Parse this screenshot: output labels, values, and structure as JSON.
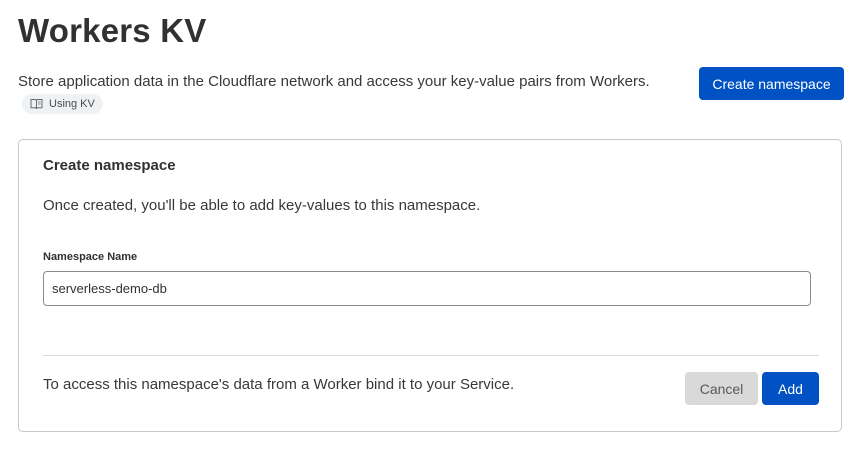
{
  "header": {
    "title": "Workers KV",
    "description": "Store application data in the Cloudflare network and access your key-value pairs from Workers.",
    "doc_link": {
      "icon": "book-icon",
      "label": "Using KV"
    },
    "create_button_label": "Create namespace"
  },
  "create_panel": {
    "title": "Create namespace",
    "description": "Once created, you'll be able to add key-values to this namespace.",
    "field_label": "Namespace Name",
    "field_value": "serverless-demo-db",
    "footer_text": "To access this namespace's data from a Worker bind it to your Service.",
    "cancel_label": "Cancel",
    "add_label": "Add"
  },
  "colors": {
    "primary": "#0051c3",
    "cancel_bg": "#d9d9d9",
    "pill_bg": "#eef2f5"
  }
}
